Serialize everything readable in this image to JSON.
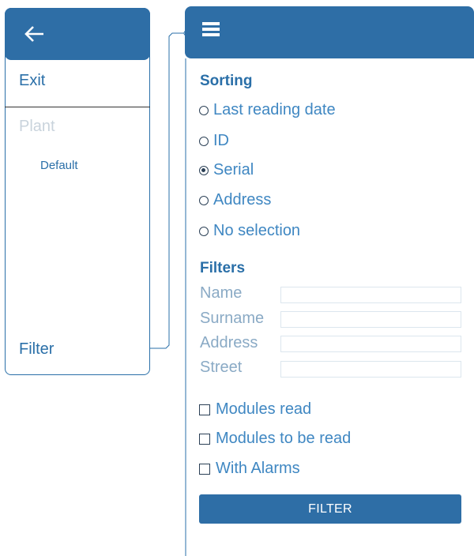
{
  "left_panel": {
    "back_icon": "arrow-left-icon",
    "menu": {
      "exit": "Exit",
      "plant": "Plant",
      "default": "Default",
      "filter": "Filter"
    }
  },
  "right_panel": {
    "menu_icon": "hamburger-menu-icon",
    "sorting": {
      "title": "Sorting",
      "options": [
        {
          "label": "Last reading date",
          "selected": false
        },
        {
          "label": "ID",
          "selected": false
        },
        {
          "label": "Serial",
          "selected": true
        },
        {
          "label": "Address",
          "selected": false
        },
        {
          "label": "No selection",
          "selected": false
        }
      ]
    },
    "filters": {
      "title": "Filters",
      "fields": [
        {
          "label": "Name",
          "value": ""
        },
        {
          "label": "Surname",
          "value": ""
        },
        {
          "label": "Address",
          "value": ""
        },
        {
          "label": "Street",
          "value": ""
        }
      ],
      "checkboxes": [
        {
          "label": "Modules read",
          "checked": false
        },
        {
          "label": "Modules to be read",
          "checked": false
        },
        {
          "label": "With Alarms",
          "checked": false
        }
      ],
      "button_label": "FILTER"
    }
  },
  "colors": {
    "accent": "#2e6ea6",
    "text_blue": "#3f87c2",
    "muted": "#8aaac5"
  }
}
